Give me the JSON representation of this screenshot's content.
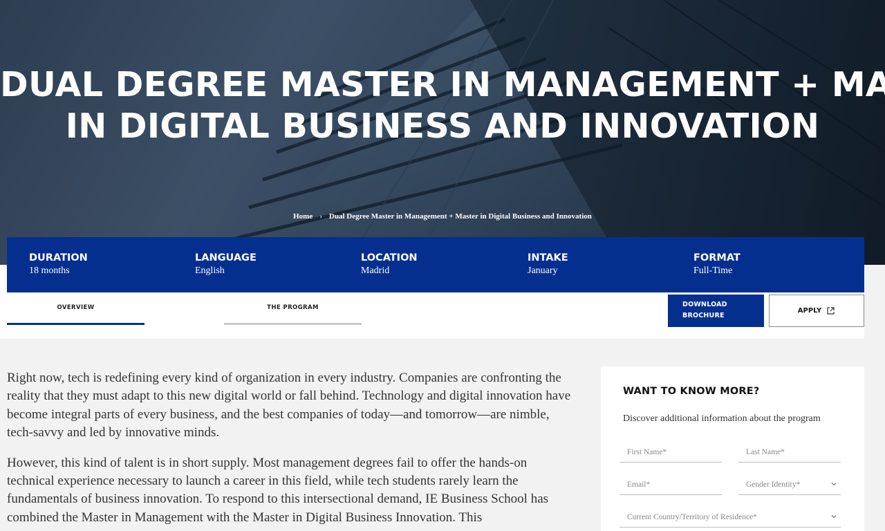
{
  "hero": {
    "title_line1": "DUAL DEGREE MASTER IN MANAGEMENT + MASTER",
    "title_line2": "IN DIGITAL BUSINESS AND INNOVATION"
  },
  "breadcrumb": {
    "home": "Home",
    "separator": "›",
    "current": "Dual Degree Master in Management + Master in Digital Business and Innovation"
  },
  "info_bar": {
    "items": [
      {
        "label": "DURATION",
        "value": "18 months"
      },
      {
        "label": "LANGUAGE",
        "value": "English"
      },
      {
        "label": "LOCATION",
        "value": "Madrid"
      },
      {
        "label": "INTAKE",
        "value": "January"
      },
      {
        "label": "FORMAT",
        "value": "Full-Time"
      }
    ]
  },
  "tabs": {
    "overview": "OVERVIEW",
    "program": "THE PROGRAM"
  },
  "actions": {
    "brochure_line1": "DOWNLOAD",
    "brochure_line2": "BROCHURE",
    "apply": "APPLY"
  },
  "content": {
    "paragraph1": "Right now, tech is redefining every kind of organization in every industry. Companies are confronting the reality that they must adapt to this new digital world or fall behind. Technology and digital innovation have become integral parts of every business, and the best companies of today—and tomorrow—are nimble, tech-savvy and led by innovative minds.",
    "paragraph2": "However, this kind of talent is in short supply. Most management degrees fail to offer the hands-on technical experience necessary to launch a career in this field, while tech students rarely learn the fundamentals of business innovation. To respond to this intersectional demand, IE Business School has combined the Master in Management with the Master in Digital Business Innovation. This"
  },
  "form": {
    "title": "WANT TO KNOW MORE?",
    "subtitle": "Discover additional information about the program",
    "first_name": "First Name*",
    "last_name": "Last Name*",
    "email": "Email*",
    "gender": "Gender Identity*",
    "country": "Current Country/Territory of Residence*"
  },
  "colors": {
    "brand_blue": "#052f8f",
    "page_gray": "#f2f2f2"
  }
}
